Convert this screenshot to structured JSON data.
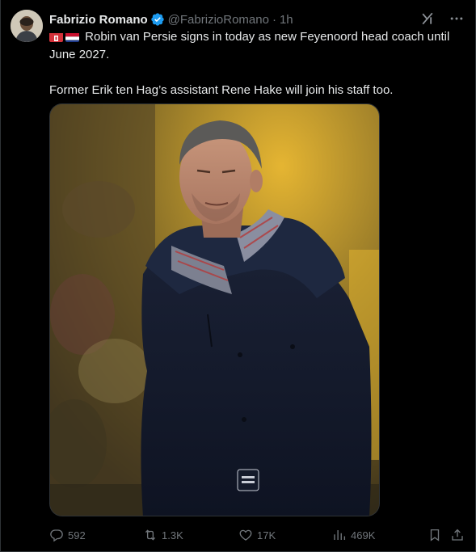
{
  "tweet": {
    "author_name": "Fabrizio Romano",
    "handle": "@FabrizioRomano",
    "separator": "·",
    "time": "1h",
    "line1": "Robin van Persie signs in today as new Feyenoord head coach until June 2027.",
    "line2": "Former Erik ten Hag’s assistant Rene Hake will join his staff too."
  },
  "icons": {
    "verified": "verified-badge-icon",
    "grok": "grok-icon",
    "more": "more-icon",
    "flag1": "feyenoord-flag-emoji",
    "flag2": "netherlands-flag-emoji"
  },
  "stats": {
    "replies": "592",
    "reposts": "1.3K",
    "likes": "17K",
    "views": "469K"
  },
  "colors": {
    "background": "#000000",
    "text": "#e7e9ea",
    "muted": "#71767b",
    "verified": "#1d9bf0"
  }
}
